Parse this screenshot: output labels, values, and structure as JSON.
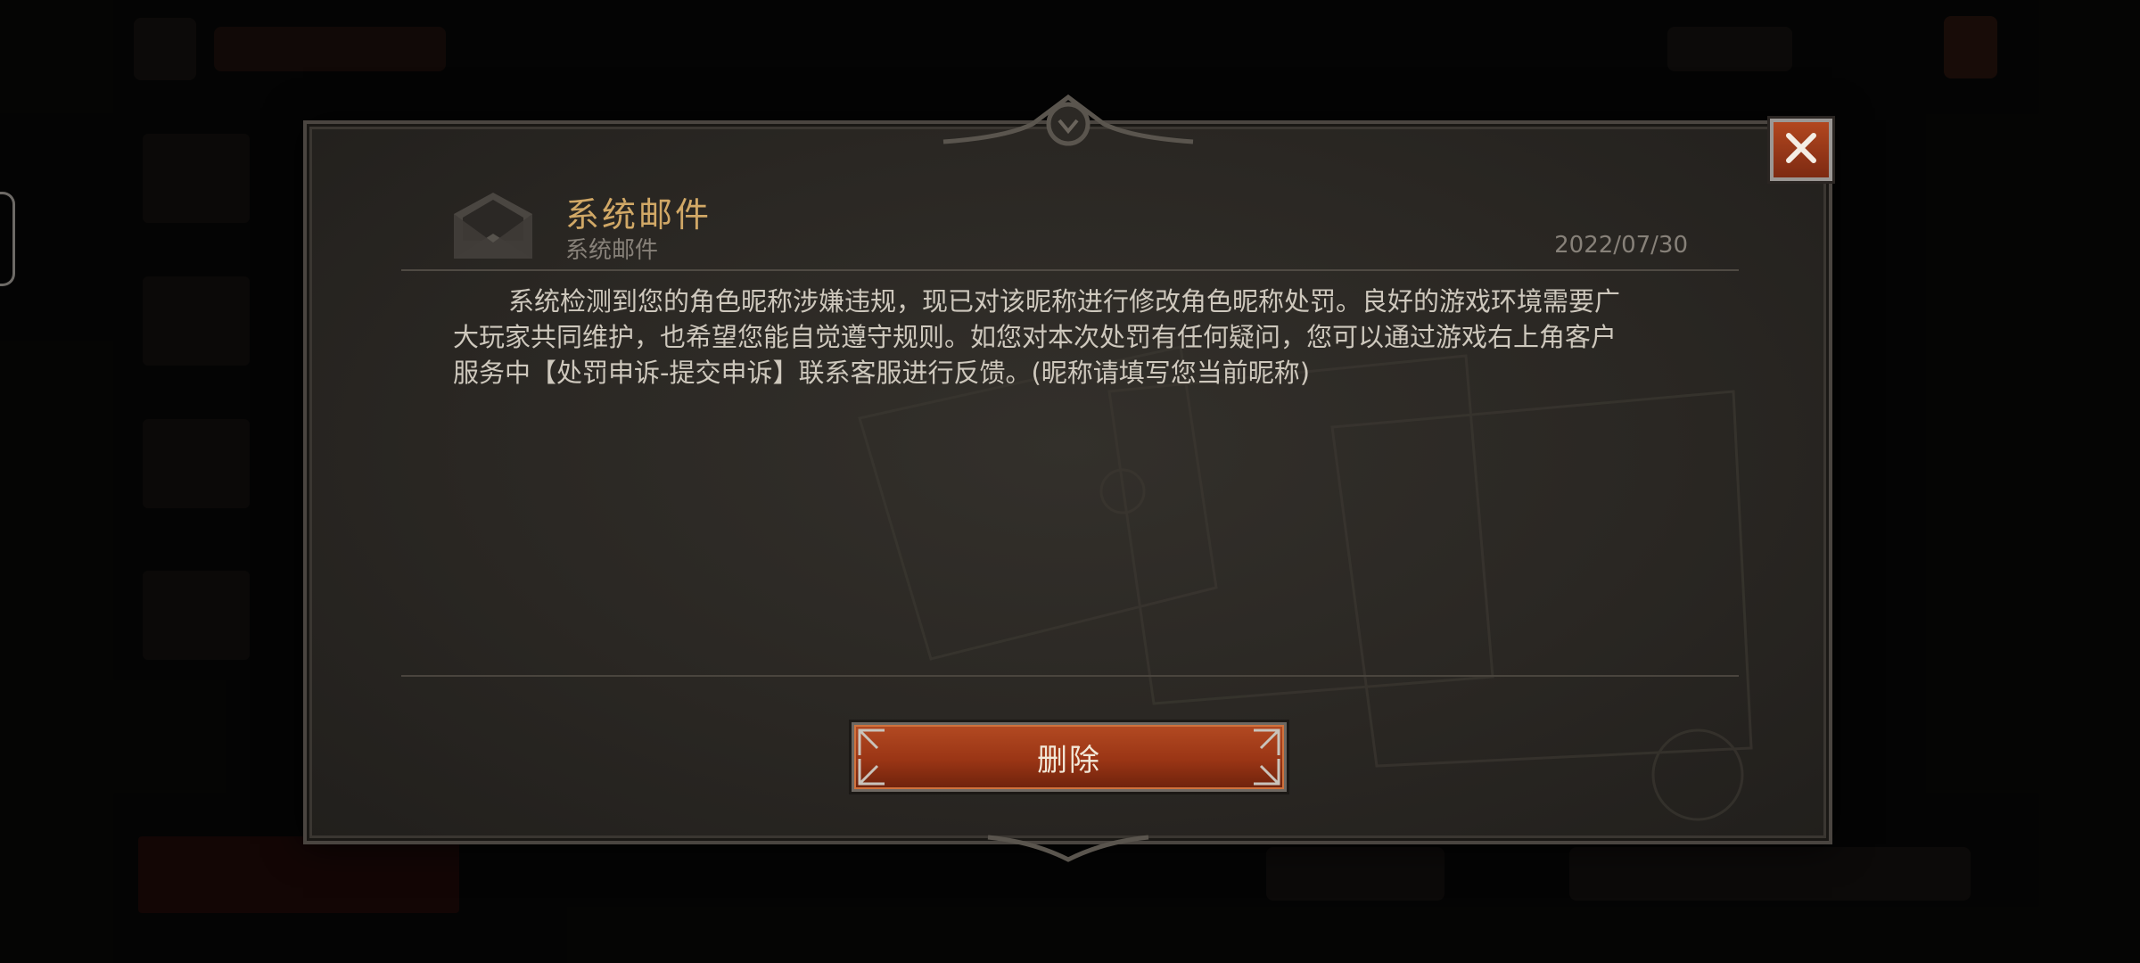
{
  "dialog": {
    "title": "系统邮件",
    "sender": "系统邮件",
    "date": "2022/07/30",
    "body": "系统检测到您的角色昵称涉嫌违规，现已对该昵称进行修改角色昵称处罚。良好的游戏环境需要广大玩家共同维护，也希望您能自觉遵守规则。如您对本次处罚有任何疑问，您可以通过游戏右上角客户服务中【处罚申诉-提交申诉】联系客服进行反馈。(昵称请填写您当前昵称)",
    "delete_label": "删除",
    "icons": {
      "mail": "envelope-icon",
      "close": "close-icon"
    }
  },
  "colors": {
    "title": "#d1a866",
    "accent_button": "#9a3515",
    "body_text": "#cec8bd",
    "meta_text": "#878179"
  }
}
